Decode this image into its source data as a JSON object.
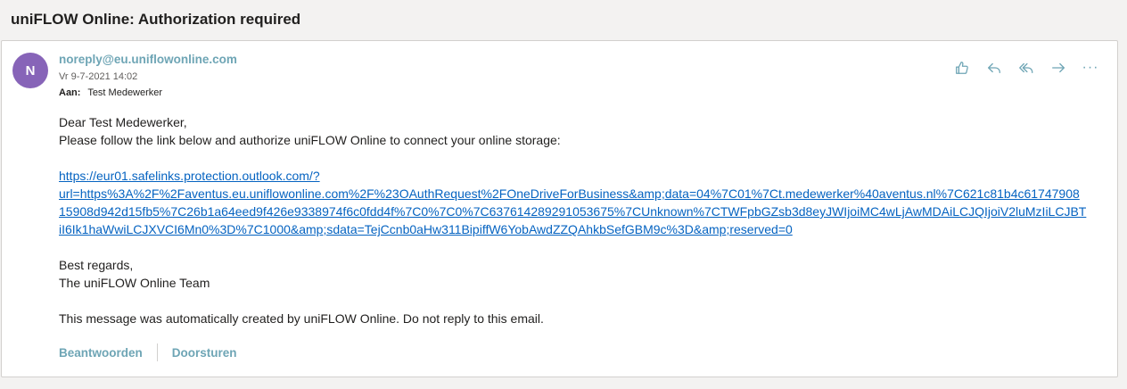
{
  "subject": "uniFLOW Online: Authorization required",
  "message": {
    "avatar_initial": "N",
    "sender": "noreply@eu.uniflowonline.com",
    "date": "Vr 9-7-2021 14:02",
    "to_label": "Aan:",
    "to_value": "Test Medewerker",
    "greeting": "Dear Test Medewerker,",
    "intro": "Please follow the link below and authorize uniFLOW Online to connect your online storage:",
    "link_lines": [
      "https://eur01.safelinks.protection.outlook.com/?",
      "url=https%3A%2F%2Faventus.eu.uniflowonline.com%2F%23OAuthRequest%2FOneDriveForBusiness&amp;data=04%7C01%7Ct.medewerker%40aventus.nl%7C621c81b4c61747908",
      "15908d942d15fb5%7C26b1a64eed9f426e9338974f6c0fdd4f%7C0%7C0%7C637614289291053675%7CUnknown%7CTWFpbGZsb3d8eyJWIjoiMC4wLjAwMDAiLCJQIjoiV2luMzIiLCJBT",
      "iI6Ik1haWwiLCJXVCI6Mn0%3D%7C1000&amp;sdata=TejCcnb0aHw311BipiffW6YobAwdZZQAhkbSefGBM9c%3D&amp;reserved=0"
    ],
    "closing": "Best regards,",
    "signature": "The uniFLOW Online Team",
    "notice": "This message was automatically created by uniFLOW Online. Do not reply to this email."
  },
  "actions": {
    "like_icon": "thumbs-up-icon",
    "reply_icon": "reply-icon",
    "reply_all_icon": "reply-all-icon",
    "forward_icon": "forward-icon",
    "more_icon": "more-icon",
    "more_glyph": "···"
  },
  "footer": {
    "reply_label": "Beantwoorden",
    "forward_label": "Doorsturen"
  },
  "colors": {
    "accent": "#6ea5b5",
    "avatar": "#8764b8",
    "link": "#0563c1"
  }
}
